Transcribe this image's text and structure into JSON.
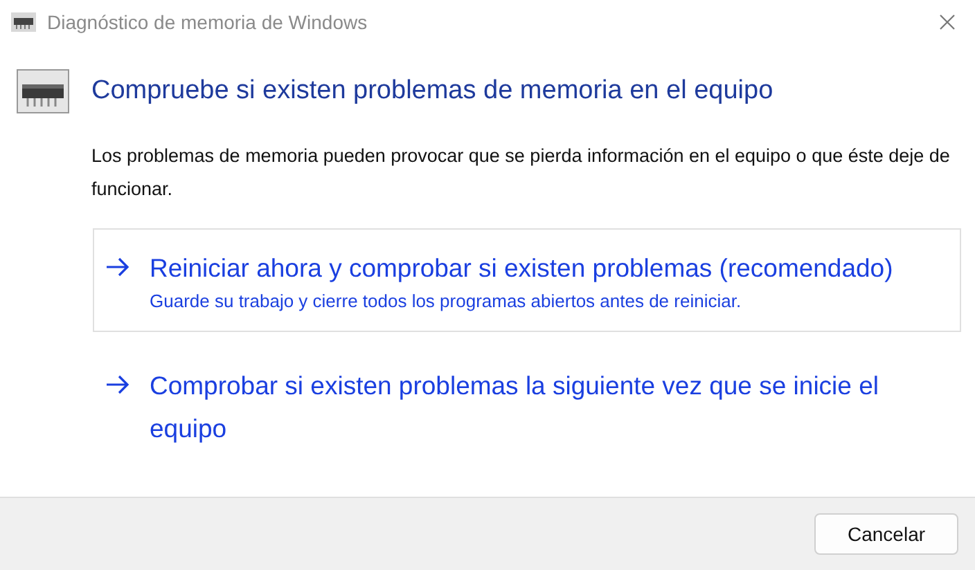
{
  "window": {
    "title": "Diagnóstico de memoria de Windows"
  },
  "heading": "Compruebe si existen problemas de memoria en el equipo",
  "description": "Los problemas de memoria pueden provocar que se pierda información en el equipo o que éste deje de funcionar.",
  "options": [
    {
      "label": "Reiniciar ahora y comprobar si existen problemas (recomendado)",
      "note": "Guarde su trabajo y cierre todos los programas abiertos antes de reiniciar.",
      "selected": true
    },
    {
      "label": "Comprobar si existen problemas la siguiente vez que se inicie el equipo",
      "selected": false
    }
  ],
  "buttons": [
    {
      "label": "Cancelar"
    }
  ]
}
